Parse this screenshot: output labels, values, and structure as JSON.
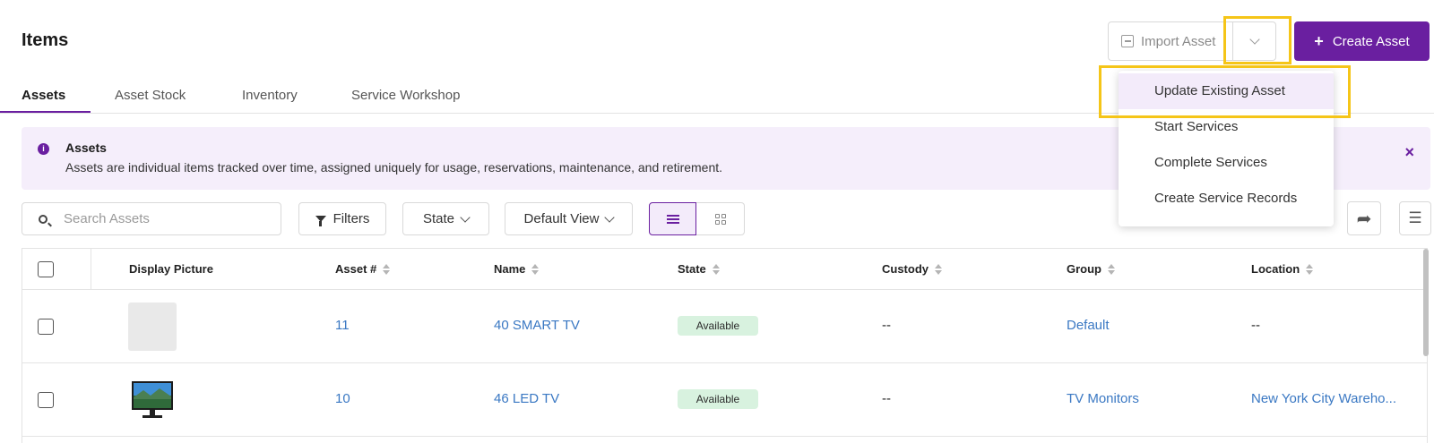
{
  "header": {
    "title": "Items",
    "import_label": "Import Asset",
    "create_label": "Create Asset",
    "create_plus": "+"
  },
  "tabs": [
    {
      "label": "Assets",
      "active": true
    },
    {
      "label": "Asset Stock",
      "active": false
    },
    {
      "label": "Inventory",
      "active": false
    },
    {
      "label": "Service Workshop",
      "active": false
    }
  ],
  "banner": {
    "title": "Assets",
    "body": "Assets are individual items tracked over time, assigned uniquely for usage, reservations, maintenance, and retirement.",
    "info_glyph": "i",
    "close_glyph": "×"
  },
  "toolbar": {
    "search_placeholder": "Search Assets",
    "search_value": "",
    "filters_label": "Filters",
    "state_label": "State",
    "view_label": "Default View",
    "share_glyph": "➦",
    "columns_glyph": "☰"
  },
  "table": {
    "columns": [
      "Display Picture",
      "Asset #",
      "Name",
      "State",
      "Custody",
      "Group",
      "Location"
    ],
    "rows": [
      {
        "asset_no": "11",
        "name": "40 SMART TV",
        "state": "Available",
        "custody": "--",
        "group": "Default",
        "location": "--",
        "picture": "placeholder-image"
      },
      {
        "asset_no": "10",
        "name": "46 LED TV",
        "state": "Available",
        "custody": "--",
        "group": "TV Monitors",
        "location": "New York City Wareho...",
        "picture": "tv-image"
      }
    ]
  },
  "dropdown_menu": {
    "items": [
      "Update Existing Asset",
      "Start Services",
      "Complete Services",
      "Create Service Records"
    ],
    "highlighted": "Update Existing Asset"
  },
  "colors": {
    "accent": "#6a1fa0",
    "highlight_box": "#f5c518",
    "link": "#3a78c3",
    "badge_available": "#d8f2df",
    "banner_bg": "#f5eefb"
  }
}
